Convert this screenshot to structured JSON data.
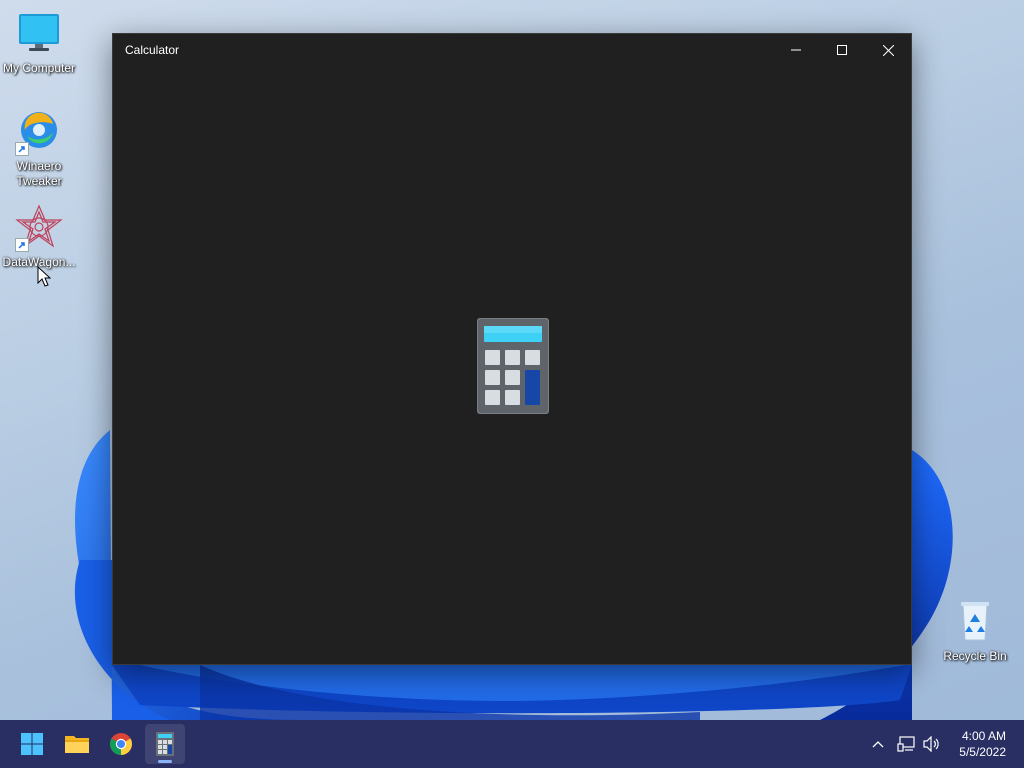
{
  "desktop": {
    "icons": [
      {
        "label": "My Computer",
        "icon": "monitor-icon"
      },
      {
        "label": "Winaero Tweaker",
        "icon": "winaero-tweaker-icon"
      },
      {
        "label": "DataWagon...",
        "icon": "datawagon-icon"
      },
      {
        "label": "Recycle Bin",
        "icon": "recycle-bin-icon"
      }
    ]
  },
  "window": {
    "title": "Calculator",
    "controls": {
      "minimize": "minimize-icon",
      "maximize": "maximize-icon",
      "close": "close-icon"
    },
    "splash_icon": "calculator-app-icon"
  },
  "taskbar": {
    "items": [
      {
        "name": "start",
        "icon": "windows-logo-icon"
      },
      {
        "name": "file-explorer",
        "icon": "folder-icon"
      },
      {
        "name": "chrome",
        "icon": "chrome-icon"
      },
      {
        "name": "calculator",
        "icon": "calculator-icon",
        "active": true
      }
    ],
    "tray": {
      "icons": [
        "chevron-up-icon",
        "network-icon",
        "volume-icon"
      ]
    },
    "clock": {
      "time": "4:00 AM",
      "date": "5/5/2022"
    }
  },
  "colors": {
    "window_bg": "#202020",
    "taskbar_bg": "#2a2f63",
    "accent": "#1e73e8"
  }
}
